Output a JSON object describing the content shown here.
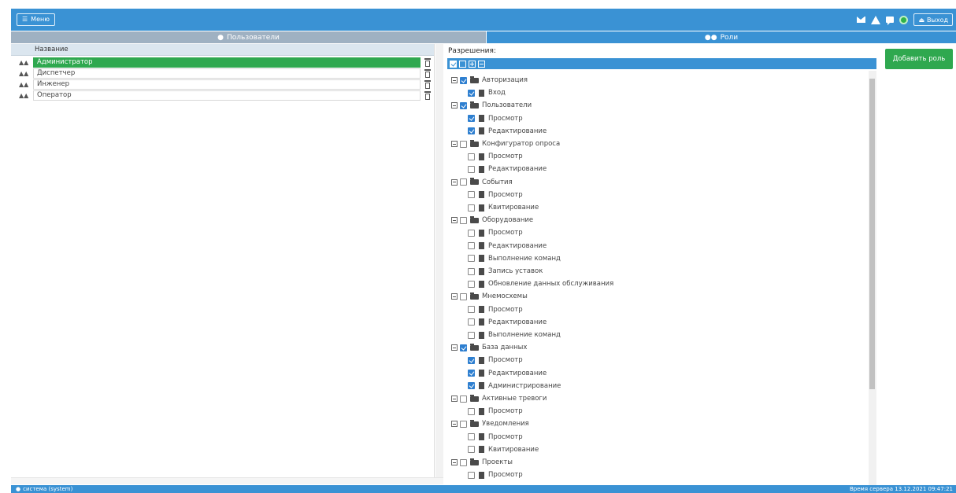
{
  "topbar": {
    "menu_label": "Меню",
    "logout_label": "Выход",
    "status_color": "#2fb34a"
  },
  "tabs": [
    {
      "label": "Пользователи",
      "active": false
    },
    {
      "label": "Роли",
      "active": true
    }
  ],
  "roles_grid": {
    "column_header": "Название",
    "rows": [
      {
        "name": "Администратор",
        "selected": true
      },
      {
        "name": "Диспетчер",
        "selected": false
      },
      {
        "name": "Инженер",
        "selected": false
      },
      {
        "name": "Оператор",
        "selected": false
      }
    ]
  },
  "permissions": {
    "label": "Разрешения:",
    "groups": [
      {
        "name": "Авторизация",
        "checked": true,
        "items": [
          {
            "name": "Вход",
            "checked": true
          }
        ]
      },
      {
        "name": "Пользователи",
        "checked": true,
        "items": [
          {
            "name": "Просмотр",
            "checked": true
          },
          {
            "name": "Редактирование",
            "checked": true
          }
        ]
      },
      {
        "name": "Конфигуратор опроса",
        "checked": false,
        "items": [
          {
            "name": "Просмотр",
            "checked": false
          },
          {
            "name": "Редактирование",
            "checked": false
          }
        ]
      },
      {
        "name": "События",
        "checked": false,
        "items": [
          {
            "name": "Просмотр",
            "checked": false
          },
          {
            "name": "Квитирование",
            "checked": false
          }
        ]
      },
      {
        "name": "Оборудование",
        "checked": false,
        "items": [
          {
            "name": "Просмотр",
            "checked": false
          },
          {
            "name": "Редактирование",
            "checked": false
          },
          {
            "name": "Выполнение команд",
            "checked": false
          },
          {
            "name": "Запись уставок",
            "checked": false
          },
          {
            "name": "Обновление данных обслуживания",
            "checked": false
          }
        ]
      },
      {
        "name": "Мнемосхемы",
        "checked": false,
        "items": [
          {
            "name": "Просмотр",
            "checked": false
          },
          {
            "name": "Редактирование",
            "checked": false
          },
          {
            "name": "Выполнение команд",
            "checked": false
          }
        ]
      },
      {
        "name": "База данных",
        "checked": true,
        "items": [
          {
            "name": "Просмотр",
            "checked": true
          },
          {
            "name": "Редактирование",
            "checked": true
          },
          {
            "name": "Администрирование",
            "checked": true
          }
        ]
      },
      {
        "name": "Активные тревоги",
        "checked": false,
        "items": [
          {
            "name": "Просмотр",
            "checked": false
          }
        ]
      },
      {
        "name": "Уведомления",
        "checked": false,
        "items": [
          {
            "name": "Просмотр",
            "checked": false
          },
          {
            "name": "Квитирование",
            "checked": false
          }
        ]
      },
      {
        "name": "Проекты",
        "checked": false,
        "items": [
          {
            "name": "Просмотр",
            "checked": false
          }
        ]
      }
    ]
  },
  "add_role_label": "Добавить роль",
  "statusbar": {
    "user": "система (system)",
    "server_time": "Время сервера 13.12.2021 09:47:21"
  },
  "colors": {
    "accent": "#3a92d4",
    "selected_row": "#2fa84f",
    "add_button": "#2fa84f",
    "inactive_tab": "#9fb1c2"
  }
}
